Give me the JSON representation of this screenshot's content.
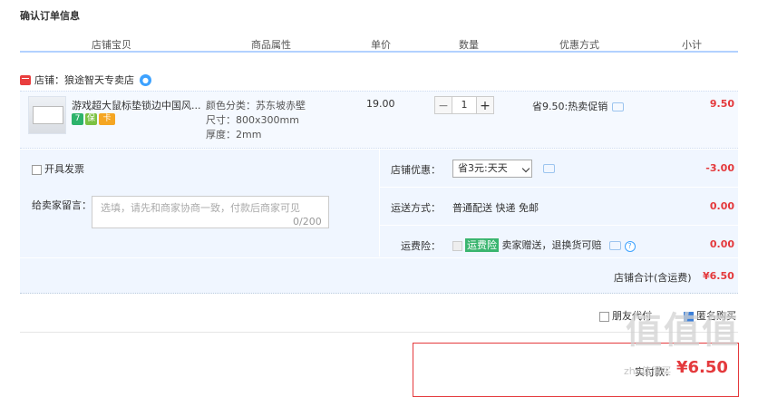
{
  "page_title": "确认订单信息",
  "headers": [
    "店铺宝贝",
    "商品属性",
    "单价",
    "数量",
    "优惠方式",
    "小计"
  ],
  "shop": {
    "label": "店铺：",
    "name": "狼途智天专卖店"
  },
  "item": {
    "name": "游戏超大鼠标垫锁边中国风...",
    "badges": [
      {
        "icon": "seven-day-return-icon",
        "text": "7",
        "color": "#2db36b"
      },
      {
        "icon": "authentic-guarantee-icon",
        "text": "保",
        "color": "#7bc142"
      },
      {
        "icon": "card-payment-icon",
        "text": "卡",
        "color": "#f5a623"
      }
    ],
    "attrs": [
      "颜色分类：苏东坡赤壁",
      "尺寸：800x300mm",
      "厚度：2mm"
    ],
    "price": "19.00",
    "qty": "1",
    "minus": "−",
    "plus": "+",
    "discount": "省9.50:热卖促销",
    "subtotal": "9.50"
  },
  "invoice_label": "开具发票",
  "message": {
    "label": "给卖家留言：",
    "placeholder": "选填，请先和商家协商一致，付款后商家可见",
    "counter": "0/200"
  },
  "shop_discount": {
    "label": "店铺优惠：",
    "value": "省3元:天天",
    "amount": "-3.00"
  },
  "shipping": {
    "label": "运送方式：",
    "value": "普通配送 快递 免邮",
    "amount": "0.00"
  },
  "insurance": {
    "label": "运费险：",
    "tag": "运费险",
    "text": "卖家赠送，退换货可赔",
    "amount": "0.00"
  },
  "shop_total": {
    "label": "店铺合计(含运费)",
    "amount": "¥6.50"
  },
  "friend_pay": "朋友代付",
  "anon_buy": "匿名购买",
  "pay": {
    "label": "实付款：",
    "amount": "¥6.50"
  },
  "watermark": {
    "main": "值值值",
    "sub": "zhi.值得买"
  },
  "colors": {
    "accent_red": "#e4393c",
    "header_line": "#b2d1ff",
    "panel_bg": "#f0f6ff"
  }
}
